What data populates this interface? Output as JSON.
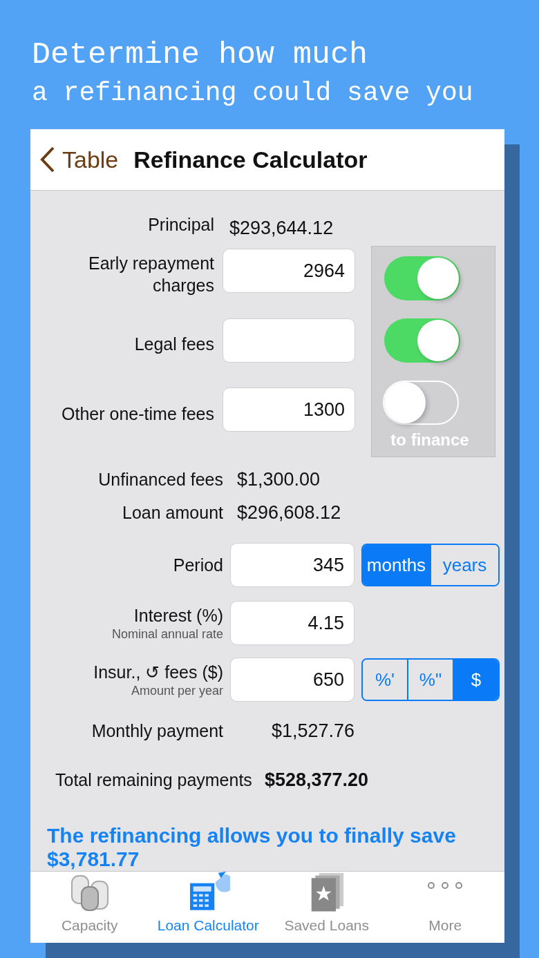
{
  "headline": [
    "Determine how much",
    "a refinancing could save you"
  ],
  "nav": {
    "back_label": "Table",
    "title": "Refinance Calculator"
  },
  "principal": {
    "label": "Principal",
    "value": "$293,644.12"
  },
  "fees": [
    {
      "label": "Early repayment charges",
      "value": "2964",
      "financed": true
    },
    {
      "label": "Legal fees",
      "financed": true
    },
    {
      "label": "Other one-time fees",
      "value": "1300",
      "financed": false
    }
  ],
  "toggle_caption": "to finance",
  "unfinanced_fees": {
    "label": "Unfinanced fees",
    "value": "$1,300.00"
  },
  "loan_amount": {
    "label": "Loan amount",
    "value": "$296,608.12"
  },
  "period": {
    "label": "Period",
    "value": "345",
    "units": [
      {
        "label": "months",
        "selected": true
      },
      {
        "label": "years",
        "selected": false
      }
    ]
  },
  "interest": {
    "label": "Interest (%)",
    "hint": "Nominal annual rate",
    "value": "4.15"
  },
  "insurance": {
    "label": "Insur., ↺ fees ($)",
    "hint": "Amount per year",
    "value": "650",
    "modes": [
      {
        "label": "%'",
        "selected": false
      },
      {
        "label": "%\"",
        "selected": false
      },
      {
        "label": "$",
        "selected": true
      }
    ]
  },
  "monthly_payment": {
    "label": "Monthly payment",
    "value": "$1,527.76"
  },
  "total_remaining": {
    "label": "Total remaining payments",
    "value": "$528,377.20"
  },
  "savings_message": "The refinancing allows you to finally save $3,781.77",
  "tabs": [
    {
      "label": "Capacity",
      "selected": false
    },
    {
      "label": "Loan Calculator",
      "selected": true
    },
    {
      "label": "Saved Loans",
      "selected": false
    },
    {
      "label": "More",
      "selected": false
    }
  ]
}
